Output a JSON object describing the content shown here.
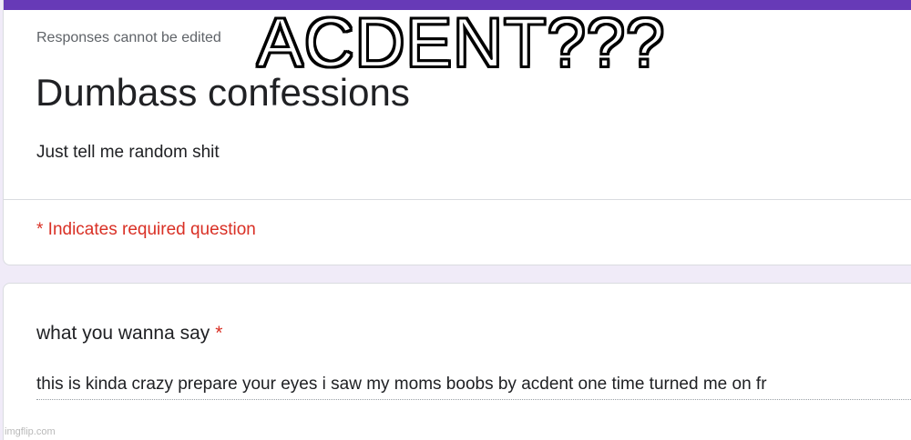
{
  "colors": {
    "accent": "#673ab7",
    "required": "#d93025",
    "background": "#f0ebf8"
  },
  "header": {
    "responses_note": "Responses cannot be edited",
    "title": "Dumbass confessions",
    "description": "Just tell me random shit",
    "required_note": "* Indicates required question"
  },
  "question": {
    "label": "what you wanna say",
    "required_marker": "*",
    "answer": "this is kinda crazy prepare your eyes i saw my moms boobs by acdent one time turned me on fr"
  },
  "overlay": {
    "caption": "ACDENT???"
  },
  "watermark": {
    "text": "imgflip.com"
  }
}
